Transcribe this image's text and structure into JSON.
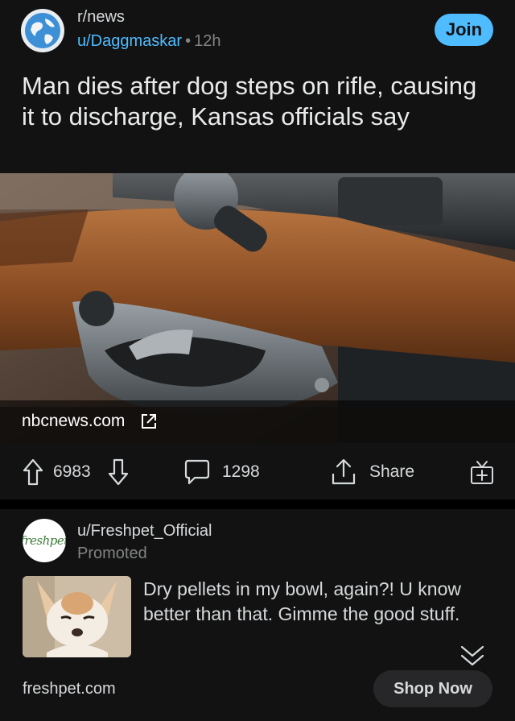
{
  "post": {
    "subreddit": "r/news",
    "author": "u/Daggmaskar",
    "separator": "•",
    "time": "12h",
    "join_label": "Join",
    "title": "Man dies after dog steps on rifle, causing it to discharge, Kansas officials say",
    "link_domain": "nbcnews.com",
    "upvotes": "6983",
    "comments": "1298",
    "share_label": "Share",
    "icons": [
      "globe-icon",
      "external-link-icon",
      "upvote-icon",
      "downvote-icon",
      "comment-icon",
      "share-icon",
      "award-icon"
    ]
  },
  "promo": {
    "author": "u/Freshpet_Official",
    "promoted_label": "Promoted",
    "logo_text": "freshpet",
    "text": "Dry pellets in my bowl, again?! U know better than that. Gimme the good stuff.",
    "domain": "freshpet.com",
    "cta_label": "Shop Now",
    "icons": [
      "freshpet-logo",
      "chevron-down-double-icon"
    ]
  },
  "colors": {
    "background": "#000000",
    "card": "#121212",
    "accent_blue": "#4fbcff",
    "text": "#d7dadc",
    "muted": "#818384"
  }
}
